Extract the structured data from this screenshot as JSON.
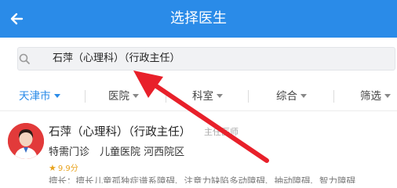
{
  "header": {
    "title": "选择医生",
    "back_icon": "back-arrow-icon",
    "background": "#2a8be8"
  },
  "search": {
    "icon": "search-icon",
    "query": "石萍（心理科）（行政主任）"
  },
  "filters": [
    {
      "label": "天津市",
      "active": true
    },
    {
      "label": "医院",
      "active": false
    },
    {
      "label": "科室",
      "active": false
    },
    {
      "label": "综合",
      "active": false
    },
    {
      "label": "筛选",
      "active": false
    }
  ],
  "doctor": {
    "name": "石萍（心理科）（行政主任）",
    "title": "主任医师",
    "hospital": "特需门诊　儿童医院 河西院区",
    "rating": "9.9分",
    "skill": "擅长：擅长儿童孤独症谱系障碍、注意力缺陷多动障碍、抽动障碍、智力障碍"
  },
  "annotation": {
    "icon": "red-pointer-arrow",
    "color": "#e8202a"
  }
}
